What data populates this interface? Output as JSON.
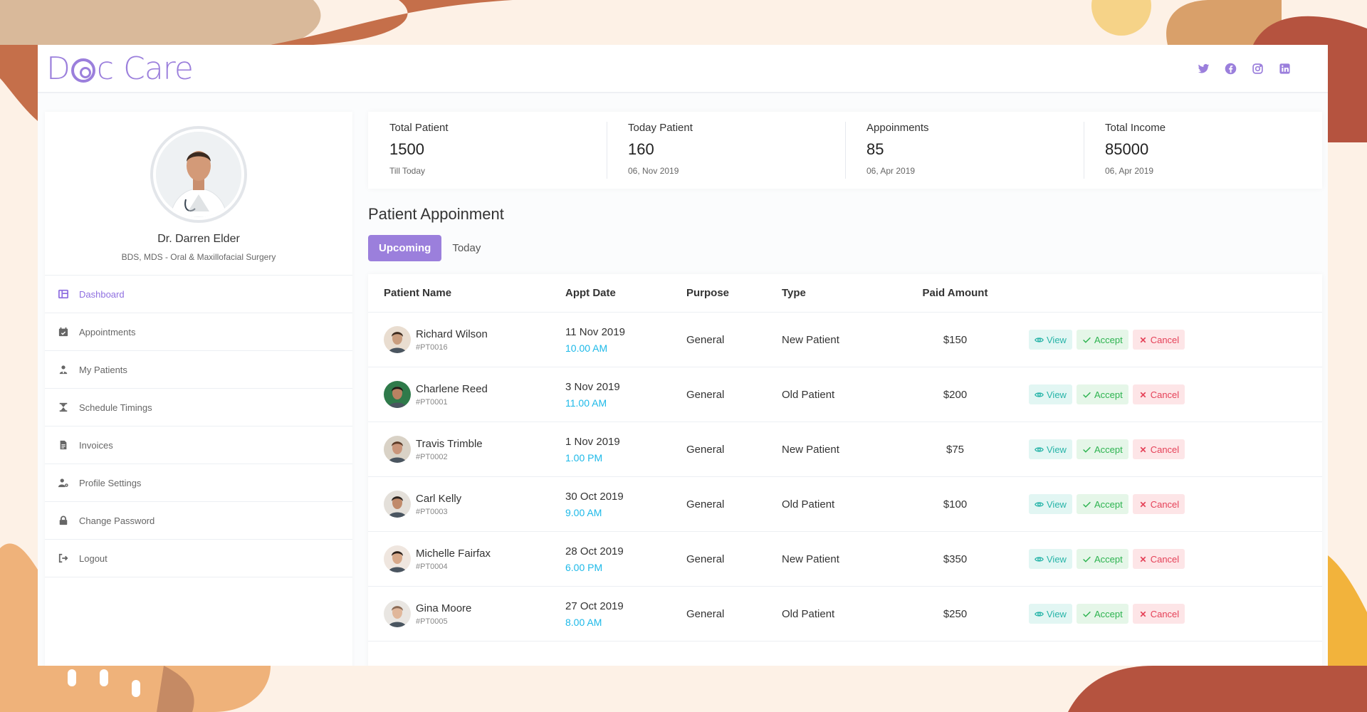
{
  "brand": {
    "logo_text": "Doc Care",
    "logo_left": "D",
    "logo_mid": "c",
    "logo_right": "Care"
  },
  "socials": [
    {
      "icon": "twitter-icon"
    },
    {
      "icon": "facebook-icon"
    },
    {
      "icon": "instagram-icon"
    },
    {
      "icon": "linkedin-icon"
    }
  ],
  "profile": {
    "name": "Dr. Darren Elder",
    "specialty": "BDS, MDS - Oral & Maxillofacial Surgery"
  },
  "menu": [
    {
      "label": "Dashboard",
      "icon": "dashboard-icon",
      "active": true
    },
    {
      "label": "Appointments",
      "icon": "calendar-icon"
    },
    {
      "label": "My Patients",
      "icon": "patients-icon"
    },
    {
      "label": "Schedule Timings",
      "icon": "hourglass-icon"
    },
    {
      "label": "Invoices",
      "icon": "invoice-icon"
    },
    {
      "label": "Profile Settings",
      "icon": "user-cog-icon"
    },
    {
      "label": "Change Password",
      "icon": "lock-icon"
    },
    {
      "label": "Logout",
      "icon": "logout-icon"
    }
  ],
  "stats": [
    {
      "label": "Total Patient",
      "value": "1500",
      "sub": "Till Today"
    },
    {
      "label": "Today Patient",
      "value": "160",
      "sub": "06, Nov 2019"
    },
    {
      "label": "Appoinments",
      "value": "85",
      "sub": "06, Apr 2019"
    },
    {
      "label": "Total Income",
      "value": "85000",
      "sub": "06, Apr 2019"
    }
  ],
  "section_title": "Patient Appoinment",
  "tabs": [
    "Upcoming",
    "Today"
  ],
  "table": {
    "headers": [
      "Patient Name",
      "Appt Date",
      "Purpose",
      "Type",
      "Paid Amount"
    ],
    "actions": {
      "view": "View",
      "accept": "Accept",
      "cancel": "Cancel"
    },
    "rows": [
      {
        "name": "Richard Wilson",
        "id": "#PT0016",
        "date": "11 Nov 2019",
        "time": "10.00 AM",
        "purpose": "General",
        "type": "New Patient",
        "paid": "$150"
      },
      {
        "name": "Charlene Reed",
        "id": "#PT0001",
        "date": "3 Nov 2019",
        "time": "11.00 AM",
        "purpose": "General",
        "type": "Old Patient",
        "paid": "$200"
      },
      {
        "name": "Travis Trimble",
        "id": "#PT0002",
        "date": "1 Nov 2019",
        "time": "1.00 PM",
        "purpose": "General",
        "type": "New Patient",
        "paid": "$75"
      },
      {
        "name": "Carl Kelly",
        "id": "#PT0003",
        "date": "30 Oct 2019",
        "time": "9.00 AM",
        "purpose": "General",
        "type": "Old Patient",
        "paid": "$100"
      },
      {
        "name": "Michelle Fairfax",
        "id": "#PT0004",
        "date": "28 Oct 2019",
        "time": "6.00 PM",
        "purpose": "General",
        "type": "New Patient",
        "paid": "$350"
      },
      {
        "name": "Gina Moore",
        "id": "#PT0005",
        "date": "27 Oct 2019",
        "time": "8.00 AM",
        "purpose": "General",
        "type": "Old Patient",
        "paid": "$250"
      }
    ]
  },
  "colors": {
    "accent": "#9b7fdc",
    "time": "#1db9e8",
    "view": "#27b4a8",
    "accept": "#2cb34f",
    "cancel": "#e54158"
  }
}
